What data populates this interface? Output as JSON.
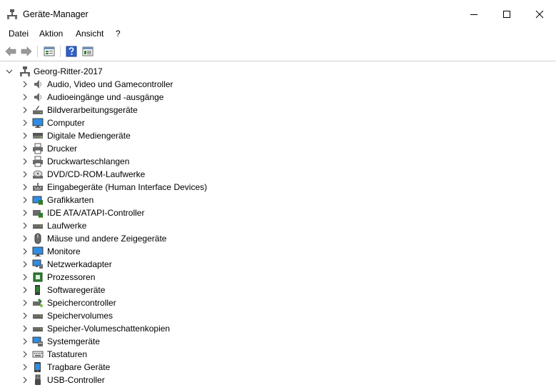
{
  "window": {
    "title": "Geräte-Manager"
  },
  "menu": [
    "Datei",
    "Aktion",
    "Ansicht",
    "?"
  ],
  "toolbar": {
    "buttons": [
      "back-icon",
      "forward-icon",
      "properties-icon",
      "help-icon",
      "view-icon"
    ]
  },
  "tree": {
    "root": "Georg-Ritter-2017",
    "categories": [
      {
        "label": "Audio, Video und Gamecontroller",
        "icon": "speaker-icon"
      },
      {
        "label": "Audioeingänge und -ausgänge",
        "icon": "speaker-icon"
      },
      {
        "label": "Bildverarbeitungsgeräte",
        "icon": "scanner-icon"
      },
      {
        "label": "Computer",
        "icon": "monitor-icon"
      },
      {
        "label": "Digitale Mediengeräte",
        "icon": "media-device-icon"
      },
      {
        "label": "Drucker",
        "icon": "printer-icon"
      },
      {
        "label": "Druckwarteschlangen",
        "icon": "printer-icon"
      },
      {
        "label": "DVD/CD-ROM-Laufwerke",
        "icon": "disc-drive-icon"
      },
      {
        "label": "Eingabegeräte (Human Interface Devices)",
        "icon": "hid-icon"
      },
      {
        "label": "Grafikkarten",
        "icon": "graphics-card-icon"
      },
      {
        "label": "IDE ATA/ATAPI-Controller",
        "icon": "ide-controller-icon"
      },
      {
        "label": "Laufwerke",
        "icon": "drive-icon"
      },
      {
        "label": "Mäuse und andere Zeigegeräte",
        "icon": "mouse-icon"
      },
      {
        "label": "Monitore",
        "icon": "monitor-icon"
      },
      {
        "label": "Netzwerkadapter",
        "icon": "network-icon"
      },
      {
        "label": "Prozessoren",
        "icon": "processor-icon"
      },
      {
        "label": "Softwaregeräte",
        "icon": "software-device-icon"
      },
      {
        "label": "Speichercontroller",
        "icon": "storage-controller-icon"
      },
      {
        "label": "Speichervolumes",
        "icon": "drive-icon"
      },
      {
        "label": "Speicher-Volumeschattenkopien",
        "icon": "drive-icon"
      },
      {
        "label": "Systemgeräte",
        "icon": "system-device-icon"
      },
      {
        "label": "Tastaturen",
        "icon": "keyboard-icon"
      },
      {
        "label": "Tragbare Geräte",
        "icon": "portable-device-icon"
      },
      {
        "label": "USB-Controller",
        "icon": "usb-icon"
      }
    ]
  }
}
